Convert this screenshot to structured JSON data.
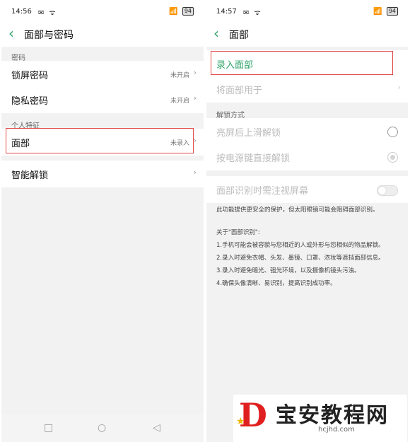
{
  "left": {
    "status": {
      "time": "14:56",
      "icons": "✉ ᯤ",
      "battery": "94"
    },
    "title": "面部与密码",
    "section_password": "密码",
    "rows": [
      {
        "label": "锁屏密码",
        "value": "未开启"
      },
      {
        "label": "隐私密码",
        "value": "未开启"
      }
    ],
    "section_personal": "个人特征",
    "face": {
      "label": "面部",
      "value": "未录入"
    },
    "smart_unlock": "智能解锁",
    "chevron": "›"
  },
  "right": {
    "status": {
      "time": "14:57",
      "icons": "✉ ᯤ",
      "battery": "94"
    },
    "title": "面部",
    "enroll_face": "录入面部",
    "use_face_for": "将面部用于",
    "section_unlock": "解锁方式",
    "unlock_options": [
      {
        "label": "亮屏后上滑解锁",
        "selected": false
      },
      {
        "label": "按电源键直接解锁",
        "selected": true
      }
    ],
    "attention": {
      "label": "面部识别时需注视屏幕",
      "on": false
    },
    "info_line": "此功能提供更安全的保护，但太阳眼镜可能会阻碍面部识别。",
    "about_title": "关于\"面部识别\":",
    "about_items": [
      "1.手机可能会被容貌与您相近的人或外形与您相似的物品解锁。",
      "2.录入时避免衣帽、头发、墨镜、口罩、浓妆等遮挡面部信息。",
      "3.录入时避免暗光、强光环境，以及摄像机镜头污浊。",
      "4.确保头像清晰、易识别，提高识别成功率。"
    ]
  },
  "watermark": {
    "brand": "宝安教程网",
    "url": "hcjhd.com"
  },
  "colors": {
    "accent": "#2ea36a",
    "highlight": "#e24a4a",
    "watermark_red": "#e02020"
  }
}
